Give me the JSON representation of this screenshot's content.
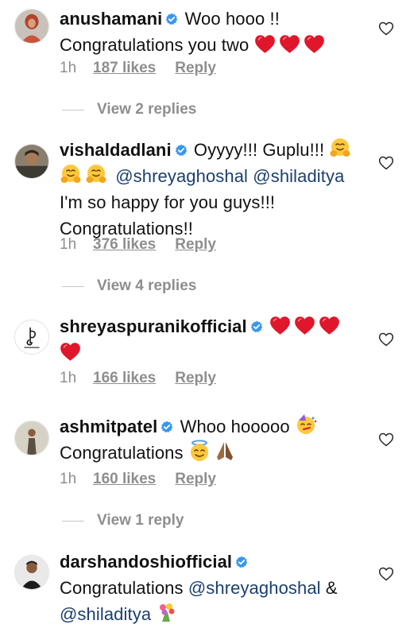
{
  "colors": {
    "text": "#111111",
    "muted": "#8e8e8e",
    "verified": "#3897f0",
    "mention": "#1b3f6d",
    "heart_emoji": "#e0162b"
  },
  "comments": [
    {
      "username": "anushamani",
      "verified": true,
      "text_a": "Woo hooo !!",
      "text_b": "Congratulations you two",
      "time": "1h",
      "likes": "187 likes",
      "reply": "Reply",
      "view_replies": "View 2 replies"
    },
    {
      "username": "vishaldadlani",
      "verified": true,
      "text_a": "Oyyyy!!! Guplu!!!",
      "mention_1": "@shreyaghoshal",
      "mention_2": "@shiladitya",
      "text_b": "I'm so happy for you guys!!!",
      "text_c": "Congratulations!!",
      "time": "1h",
      "likes": "376 likes",
      "reply": "Reply",
      "view_replies": "View 4 replies"
    },
    {
      "username": "shreyaspuranikofficial",
      "verified": true,
      "time": "1h",
      "likes": "166 likes",
      "reply": "Reply"
    },
    {
      "username": "ashmitpatel",
      "verified": true,
      "text_a": "Whoo hooooo",
      "text_b": "Congratulations",
      "time": "1h",
      "likes": "160 likes",
      "reply": "Reply",
      "view_replies": "View 1 reply"
    },
    {
      "username": "darshandoshiofficial",
      "verified": true,
      "text_a": "Congratulations",
      "mention_1": "@shreyaghoshal",
      "text_b": "&",
      "mention_2": "@shiladitya"
    }
  ],
  "icons": {
    "verified": "verified-badge-icon",
    "like": "heart-outline-icon",
    "red_heart": "red-heart-emoji",
    "hug": "hugging-face-emoji",
    "party": "partying-face-emoji",
    "halo": "smiling-face-with-halo-emoji",
    "pray": "folded-hands-emoji",
    "bouquet": "bouquet-emoji"
  }
}
